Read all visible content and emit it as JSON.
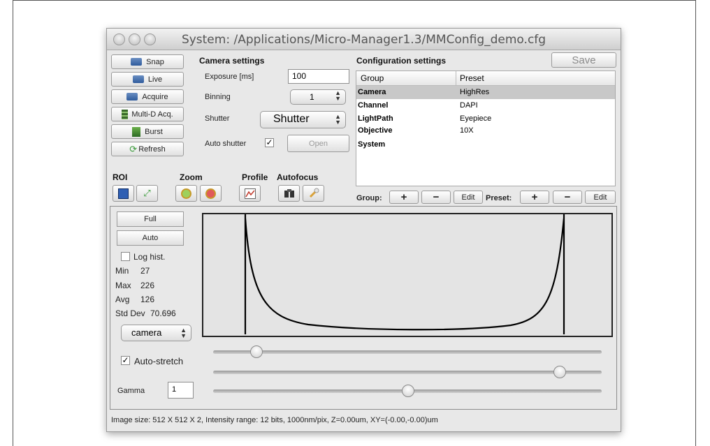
{
  "window": {
    "title": "System: /Applications/Micro-Manager1.3/MMConfig_demo.cfg"
  },
  "left_buttons": [
    "Snap",
    "Live",
    "Acquire",
    "Multi-D Acq.",
    "Burst",
    "Refresh"
  ],
  "camera_settings": {
    "heading": "Camera settings",
    "exposure_label": "Exposure [ms]",
    "exposure_value": "100",
    "binning_label": "Binning",
    "binning_value": "1",
    "shutter_label": "Shutter",
    "shutter_value": "Shutter",
    "auto_shutter_label": "Auto shutter",
    "auto_shutter_checked": "✓",
    "open_button": "Open"
  },
  "toolbar_sections": {
    "roi": "ROI",
    "zoom": "Zoom",
    "profile": "Profile",
    "autofocus": "Autofocus"
  },
  "configuration": {
    "heading": "Configuration settings",
    "save_label": "Save",
    "columns": [
      "Group",
      "Preset"
    ],
    "rows": [
      {
        "group": "Camera",
        "preset": "HighRes"
      },
      {
        "group": "Channel",
        "preset": "DAPI"
      },
      {
        "group": "LightPath",
        "preset": "Eyepiece"
      },
      {
        "group": "Objective",
        "preset": "10X"
      },
      {
        "group": "System",
        "preset": ""
      }
    ],
    "group_label": "Group:",
    "preset_label": "Preset:",
    "plus": "+",
    "minus": "−",
    "edit": "Edit"
  },
  "histogram": {
    "full_label": "Full",
    "auto_label": "Auto",
    "log_hist_label": "Log hist.",
    "min_label": "Min",
    "min_value": "27",
    "max_label": "Max",
    "max_value": "226",
    "avg_label": "Avg",
    "avg_value": "126",
    "std_label": "Std Dev",
    "std_value": "70.696",
    "channel_select": "camera",
    "auto_stretch_label": "Auto-stretch",
    "auto_stretch_checked": "✓",
    "gamma_label": "Gamma",
    "gamma_value": "1",
    "slider_levels": {
      "min": 0.11,
      "max": 0.89,
      "gamma": 0.5
    }
  },
  "status_bar": "Image size: 512 X 512 X 2, Intensity range: 12 bits, 1000nm/pix, Z=0.00um, XY=(-0.00,-0.00)um"
}
